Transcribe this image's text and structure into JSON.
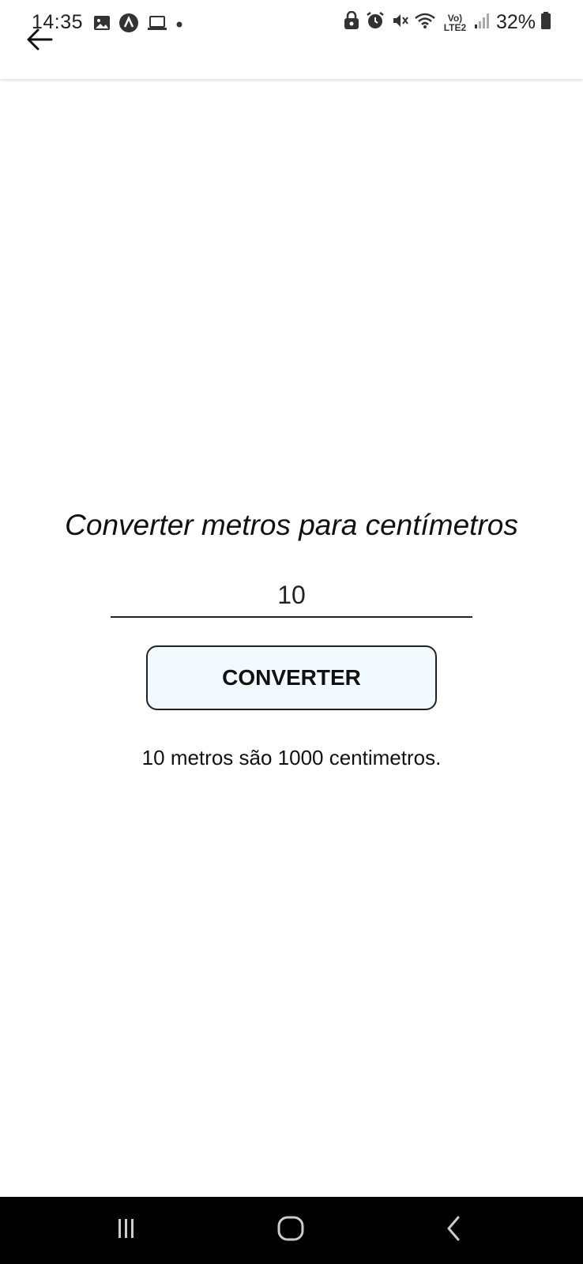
{
  "status_bar": {
    "time": "14:35",
    "battery": "32%",
    "network_label": "Vo) LTE2"
  },
  "header": {
    "back_icon": "arrow-back-icon"
  },
  "main": {
    "title": "Converter metros para centímetros",
    "input_value": "10",
    "button_label": "CONVERTER",
    "result_text": "10 metros são 1000 centimetros."
  },
  "nav_bar": {
    "recents_icon": "recents-icon",
    "home_icon": "home-icon",
    "back_icon": "back-icon"
  },
  "colors": {
    "button_bg": "#f2f9ff",
    "caret": "#0a7f7a",
    "nav_bg": "#000000"
  }
}
